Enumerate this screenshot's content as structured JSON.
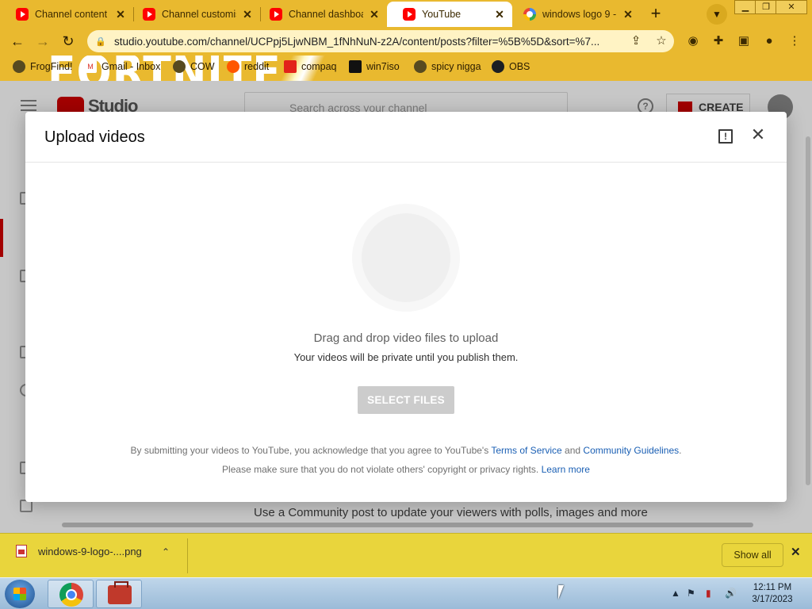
{
  "browser": {
    "tabs": [
      {
        "title": "Channel content",
        "icon": "youtube-icon",
        "active": false
      },
      {
        "title": "Channel customis",
        "icon": "youtube-icon",
        "active": false
      },
      {
        "title": "Channel dashboar",
        "icon": "youtube-icon",
        "active": false
      },
      {
        "title": "YouTube",
        "icon": "youtube-icon",
        "active": true
      },
      {
        "title": "windows logo 9 -",
        "icon": "google-icon",
        "active": false
      }
    ],
    "url": "studio.youtube.com/channel/UCPpj5LjwNBM_1fNhNuN-z2A/content/posts?filter=%5B%5D&sort=%7...",
    "bookmarks": [
      {
        "label": "FrogFind!",
        "icon": "frogfind-icon"
      },
      {
        "label": "Gmail - Inbox",
        "icon": "gmail-icon"
      },
      {
        "label": "COW",
        "icon": "globe-icon"
      },
      {
        "label": "reddit",
        "icon": "reddit-icon"
      },
      {
        "label": "compaq",
        "icon": "compaq-icon"
      },
      {
        "label": "win7iso",
        "icon": "win7iso-icon"
      },
      {
        "label": "spicy nigga",
        "icon": "globe-icon"
      },
      {
        "label": "OBS",
        "icon": "github-icon"
      }
    ],
    "theme_banner_text": "FORTNITE"
  },
  "studio": {
    "logo_text": "Studio",
    "search_placeholder": "Search across your channel",
    "create_label": "CREATE",
    "community_hint": "Use a Community post to update your viewers with polls, images and more"
  },
  "dialog": {
    "title": "Upload videos",
    "drag_text": "Drag and drop video files to upload",
    "private_text": "Your videos will be private until you publish them.",
    "select_button": "SELECT FILES",
    "legal_prefix": "By submitting your videos to YouTube, you acknowledge that you agree to YouTube's",
    "terms_link": "Terms of Service",
    "legal_and": "and",
    "guidelines_link": "Community Guidelines",
    "legal_suffix": ".",
    "legal_line2": "Please make sure that you do not violate others' copyright or privacy rights.",
    "learn_more_link": "Learn more"
  },
  "downloads": {
    "file_name": "windows-9-logo-....png",
    "show_all_label": "Show all"
  },
  "taskbar": {
    "time": "12:11 PM",
    "date": "3/17/2023"
  },
  "colors": {
    "browser_theme": "#e9b92f",
    "download_bar": "#e9d53c",
    "link": "#1a5fb4",
    "select_button_disabled": "#cccccc"
  }
}
